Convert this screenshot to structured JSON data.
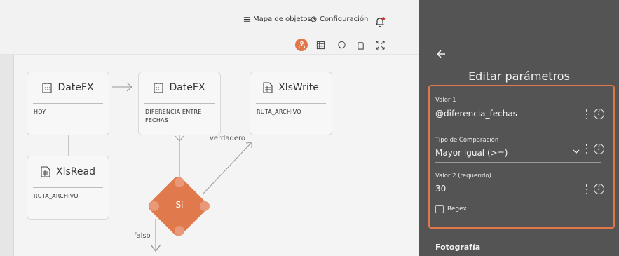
{
  "topnav": {
    "object_map_label": "Mapa de objetos",
    "settings_label": "Configuración"
  },
  "nodes": {
    "datefx_1": {
      "title": "DateFX",
      "param": "HOY"
    },
    "datefx_2": {
      "title": "DateFX",
      "param": "DIFERENCIA ENTRE FECHAS"
    },
    "xlswrite": {
      "title": "XlsWrite",
      "param": "RUTA_ARCHIVO"
    },
    "xlsread": {
      "title": "XlsRead",
      "param": "RUTA_ARCHIVO"
    },
    "condition": {
      "label": "Sí"
    }
  },
  "edges": {
    "true_label": "verdadero",
    "false_label": "falso"
  },
  "panel": {
    "title": "Editar parámetros",
    "value1": {
      "label": "Valor 1",
      "value": "@diferencia_fechas"
    },
    "comparison": {
      "label": "Tipo de Comparación",
      "value": "Mayor igual (>=)"
    },
    "value2": {
      "label": "Valor 2 (requerido)",
      "value": "30"
    },
    "regex_label": "Regex",
    "photo_section": "Fotografía"
  },
  "colors": {
    "accent": "#e0764a",
    "panel_bg": "#545454",
    "canvas_bg": "#f2f2f2"
  }
}
